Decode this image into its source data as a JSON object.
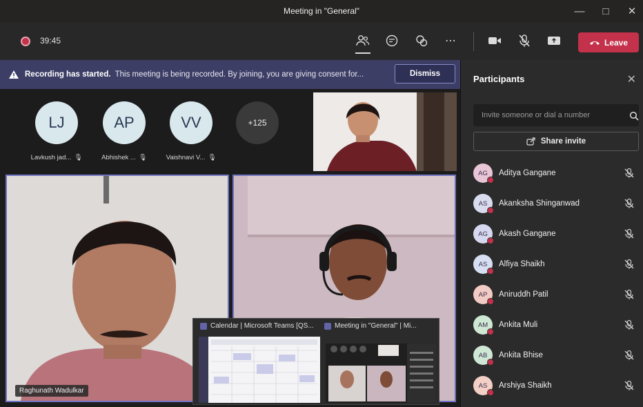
{
  "window": {
    "title": "Meeting in \"General\""
  },
  "controls": {
    "timer": "39:45",
    "leave_label": "Leave"
  },
  "banner": {
    "bold": "Recording has started.",
    "text": "This meeting is being recorded. By joining, you are giving consent for...",
    "dismiss_label": "Dismiss"
  },
  "stage": {
    "avatars": [
      {
        "initials": "LJ",
        "name": "Lavkush jad..."
      },
      {
        "initials": "AP",
        "name": "Abhishek ..."
      },
      {
        "initials": "VV",
        "name": "Vaishnavi V..."
      }
    ],
    "overflow": "+125",
    "tiles": {
      "left_name": "Raghunath Wadulkar"
    }
  },
  "thumbnails": [
    {
      "title": "Calendar | Microsoft Teams [QS..."
    },
    {
      "title": "Meeting in \"General\" | Mi..."
    }
  ],
  "participants": {
    "title": "Participants",
    "invite_placeholder": "Invite someone or dial a number",
    "share_label": "Share invite",
    "list": [
      {
        "initials": "AG",
        "name": "Aditya Gangane",
        "color": "#e8c6d6"
      },
      {
        "initials": "AS",
        "name": "Akanksha Shinganwad",
        "color": "#d9dcef"
      },
      {
        "initials": "AG",
        "name": "Akash Gangane",
        "color": "#d6d8f0"
      },
      {
        "initials": "AS",
        "name": "Alfiya Shaikh",
        "color": "#d7e0f2"
      },
      {
        "initials": "AP",
        "name": "Aniruddh Patil",
        "color": "#f2cbc4"
      },
      {
        "initials": "AM",
        "name": "Ankita Muli",
        "color": "#cfe8d4"
      },
      {
        "initials": "AB",
        "name": "Ankita Bhise",
        "color": "#cfe8d6"
      },
      {
        "initials": "AS",
        "name": "Arshiya Shaikh",
        "color": "#f3cfc6"
      }
    ]
  }
}
